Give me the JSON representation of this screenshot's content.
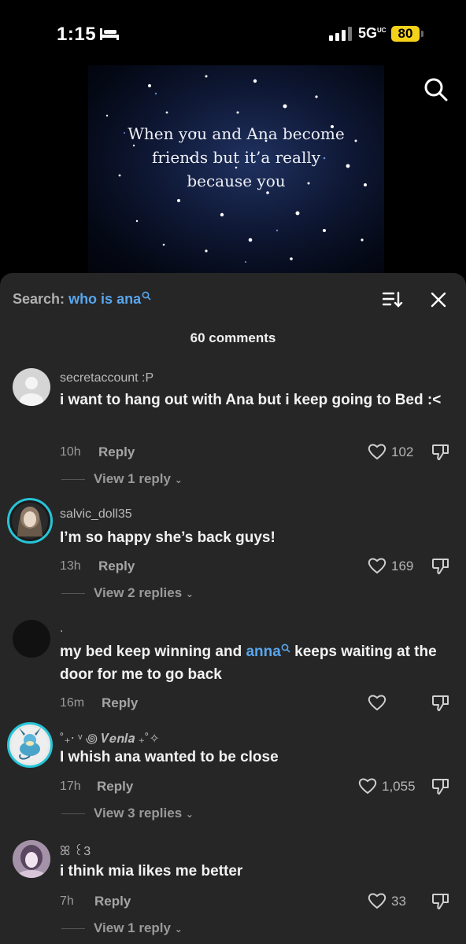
{
  "status": {
    "time": "1:15",
    "network": "5G",
    "network_sup": "UC",
    "battery": "80"
  },
  "video": {
    "caption_lines": [
      "When you and Ana become",
      "friends but it’a really",
      "because you"
    ]
  },
  "sheet": {
    "search_label": "Search:",
    "search_term": "who is ana",
    "count": "60 comments",
    "comments": [
      {
        "user": "secretaccount :P",
        "text": "i want to hang out with Ana but i keep going to Bed :<",
        "time": "10h",
        "reply": "Reply",
        "likes": "102",
        "view": "View 1 reply"
      },
      {
        "user": "salvic_doll35",
        "text": "I’m so happy she’s back guys!",
        "time": "13h",
        "reply": "Reply",
        "likes": "169",
        "view": "View 2 replies"
      },
      {
        "user": ".",
        "text_pre": "my bed keep winning and ",
        "text_link": "anna",
        "text_post": " keeps waiting at the door for me to go back",
        "time": "16m",
        "reply": "Reply",
        "likes": ""
      },
      {
        "user": "˚₊‧ ᵛ ꩜ 𝑽𝒆𝒏𝒍𝒂 ₊˚✧",
        "text": "I whish ana wanted to be close",
        "time": "17h",
        "reply": "Reply",
        "likes": "1,055",
        "view": "View 3 replies"
      },
      {
        "user": "ꕤ ꒰3",
        "text": "i think mia likes me better",
        "time": "7h",
        "reply": "Reply",
        "likes": "33",
        "view": "View 1 reply"
      }
    ]
  }
}
